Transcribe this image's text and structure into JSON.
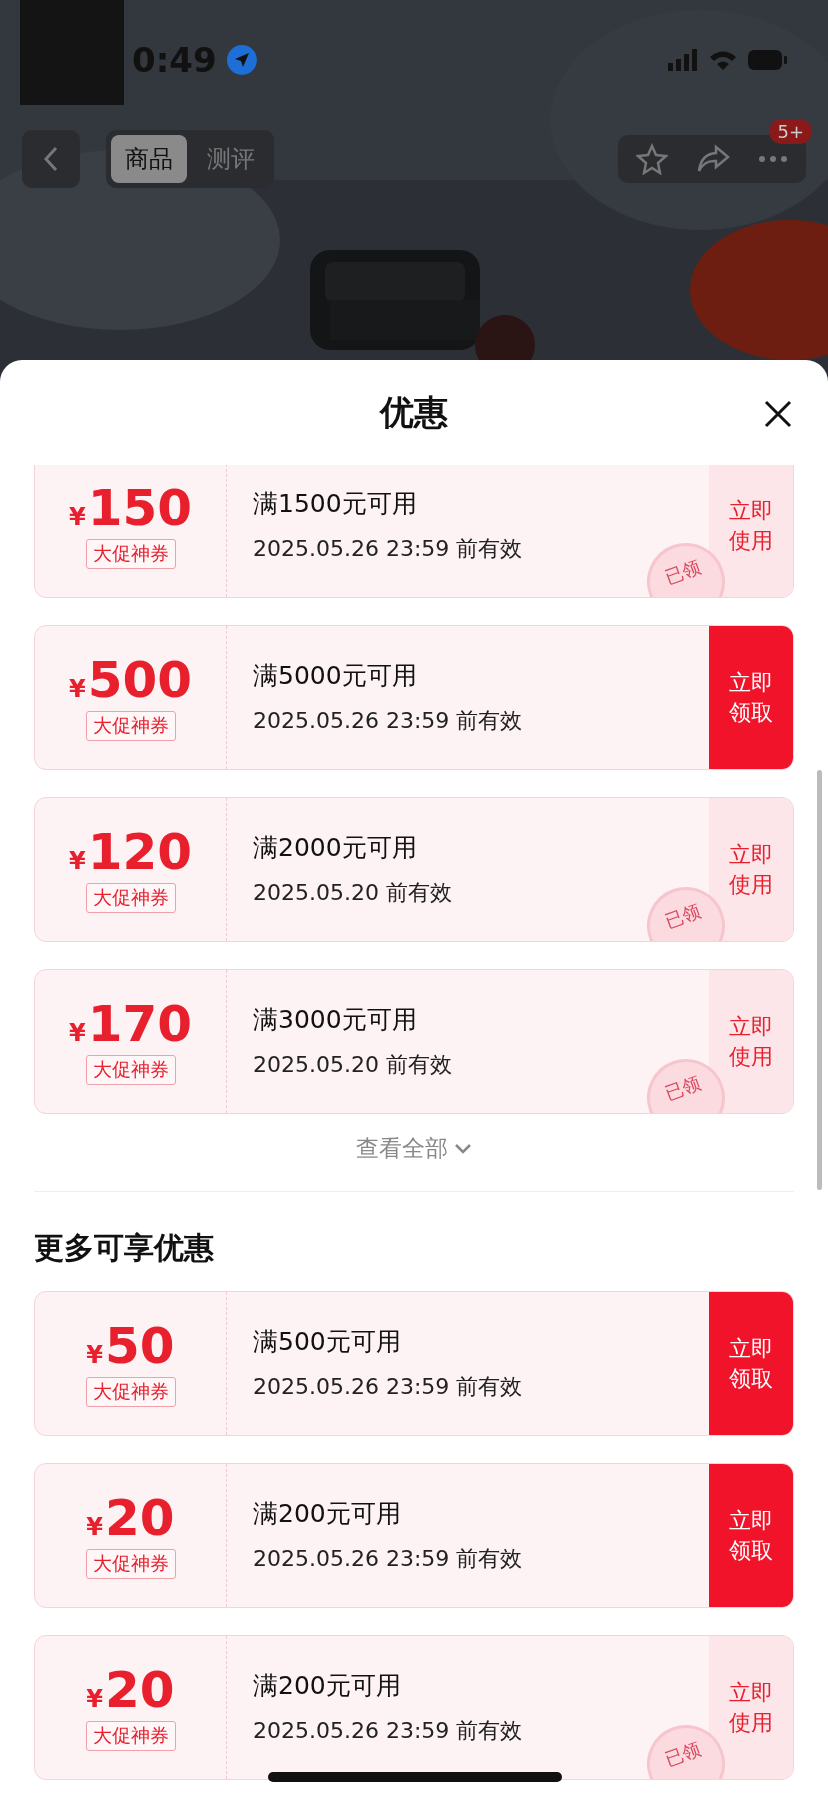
{
  "status_bar": {
    "time": "0:49"
  },
  "nav": {
    "tabs": [
      {
        "label": "商品",
        "selected": true
      },
      {
        "label": "测评",
        "selected": false
      }
    ],
    "more_badge": "5+"
  },
  "sheet": {
    "title": "优惠",
    "coupons": [
      {
        "currency": "¥",
        "amount": "150",
        "tag": "大促神券",
        "condition": "满1500元可用",
        "expiry": "2025.05.26 23:59 前有效",
        "action": "立即使用",
        "claimed": true,
        "stamp": "已领"
      },
      {
        "currency": "¥",
        "amount": "500",
        "tag": "大促神券",
        "condition": "满5000元可用",
        "expiry": "2025.05.26 23:59 前有效",
        "action": "立即领取",
        "claimed": false
      },
      {
        "currency": "¥",
        "amount": "120",
        "tag": "大促神券",
        "condition": "满2000元可用",
        "expiry": "2025.05.20 前有效",
        "action": "立即使用",
        "claimed": true,
        "stamp": "已领"
      },
      {
        "currency": "¥",
        "amount": "170",
        "tag": "大促神券",
        "condition": "满3000元可用",
        "expiry": "2025.05.20 前有效",
        "action": "立即使用",
        "claimed": true,
        "stamp": "已领"
      }
    ],
    "view_all": "查看全部",
    "more_section": {
      "title": "更多可享优惠",
      "coupons": [
        {
          "currency": "¥",
          "amount": "50",
          "tag": "大促神券",
          "condition": "满500元可用",
          "expiry": "2025.05.26 23:59 前有效",
          "action": "立即领取",
          "claimed": false
        },
        {
          "currency": "¥",
          "amount": "20",
          "tag": "大促神券",
          "condition": "满200元可用",
          "expiry": "2025.05.26 23:59 前有效",
          "action": "立即领取",
          "claimed": false
        },
        {
          "currency": "¥",
          "amount": "20",
          "tag": "大促神券",
          "condition": "满200元可用",
          "expiry": "2025.05.26 23:59 前有效",
          "action": "立即使用",
          "claimed": true,
          "stamp": "已领"
        }
      ]
    }
  }
}
